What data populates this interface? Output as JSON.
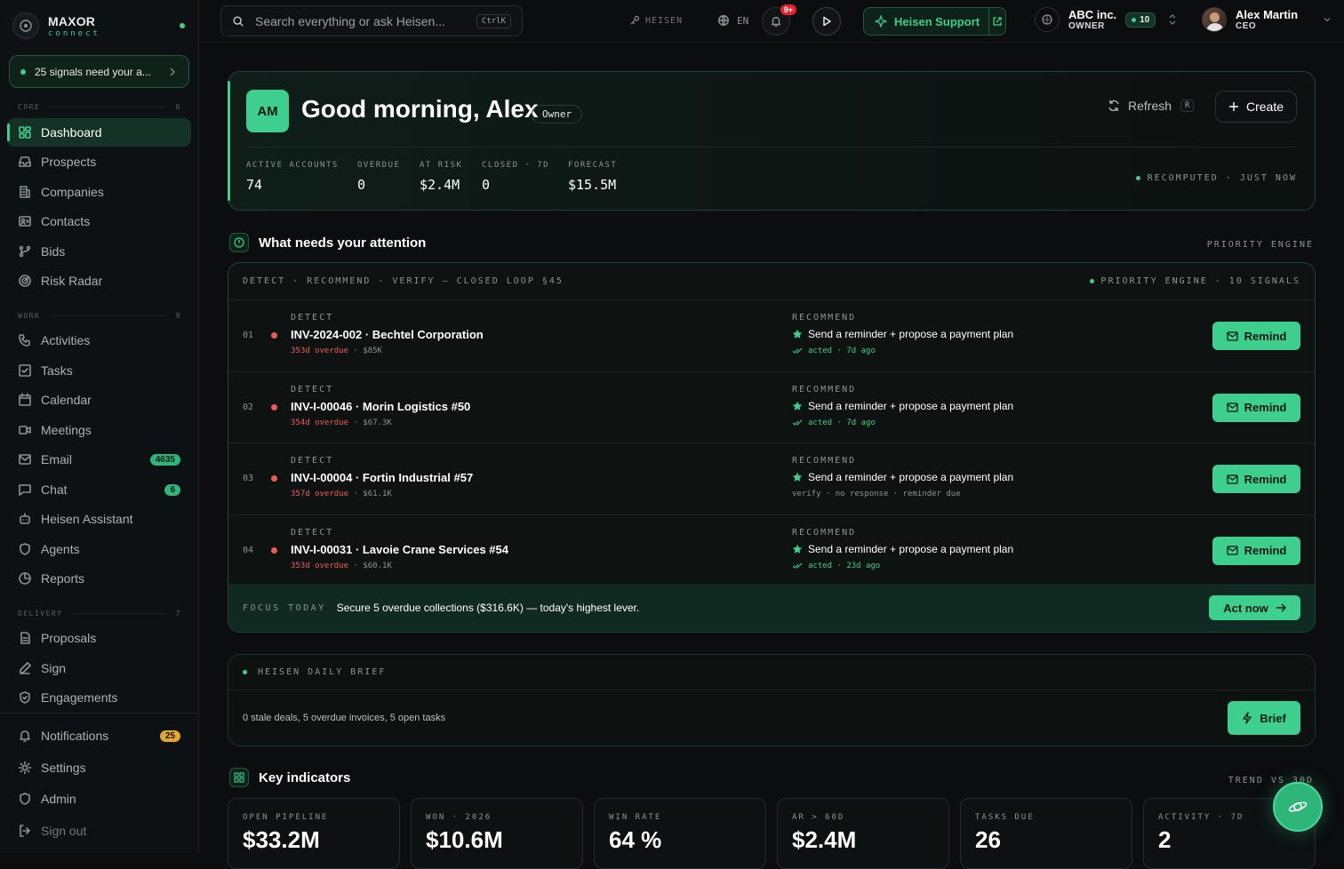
{
  "brand": {
    "name": "MAXOR",
    "sub": "connect"
  },
  "signals_banner": "25 signals need your a...",
  "sidebar": {
    "sections": [
      {
        "label": "CORE",
        "count": "6"
      },
      {
        "label": "WORK",
        "count": "9"
      },
      {
        "label": "DELIVERY",
        "count": "7"
      }
    ],
    "core": [
      {
        "label": "Dashboard",
        "icon": "dashboard-icon"
      },
      {
        "label": "Prospects",
        "icon": "inbox-icon"
      },
      {
        "label": "Companies",
        "icon": "building-icon"
      },
      {
        "label": "Contacts",
        "icon": "contact-card-icon"
      },
      {
        "label": "Bids",
        "icon": "branch-icon"
      },
      {
        "label": "Risk Radar",
        "icon": "radar-icon"
      }
    ],
    "work": [
      {
        "label": "Activities",
        "icon": "phone-icon"
      },
      {
        "label": "Tasks",
        "icon": "checkbox-icon"
      },
      {
        "label": "Calendar",
        "icon": "calendar-icon"
      },
      {
        "label": "Meetings",
        "icon": "video-icon"
      },
      {
        "label": "Email",
        "icon": "mail-icon",
        "badge": "4635"
      },
      {
        "label": "Chat",
        "icon": "chat-icon",
        "badge": "6"
      },
      {
        "label": "Heisen Assistant",
        "icon": "bot-icon"
      },
      {
        "label": "Agents",
        "icon": "shield-icon"
      },
      {
        "label": "Reports",
        "icon": "pie-chart-icon"
      }
    ],
    "delivery": [
      {
        "label": "Proposals",
        "icon": "document-icon"
      },
      {
        "label": "Sign",
        "icon": "pen-icon"
      },
      {
        "label": "Engagements",
        "icon": "shield-check-icon"
      }
    ],
    "bottom": [
      {
        "label": "Notifications",
        "icon": "bell-icon",
        "badge": "25"
      },
      {
        "label": "Settings",
        "icon": "gear-icon"
      },
      {
        "label": "Admin",
        "icon": "shield-icon"
      },
      {
        "label": "Sign out",
        "icon": "logout-icon"
      }
    ]
  },
  "topbar": {
    "search_placeholder": "Search everything or ask Heisen...",
    "search_kbd": "CtrlK",
    "heisen": "HEISEN",
    "lang": "EN",
    "notif_badge": "9+",
    "support": "Heisen Support",
    "org_name": "ABC inc.",
    "org_role": "OWNER",
    "org_count": "10",
    "user_name": "Alex Martin",
    "user_role": "CEO"
  },
  "hero": {
    "initials": "AM",
    "greeting": "Good morning, Alex",
    "role_tag": "Owner",
    "refresh": "Refresh",
    "refresh_kbd": "R",
    "create": "Create",
    "stats": [
      {
        "label": "ACTIVE ACCOUNTS",
        "value": "74"
      },
      {
        "label": "OVERDUE",
        "value": "0"
      },
      {
        "label": "AT RISK",
        "value": "$2.4M"
      },
      {
        "label": "CLOSED · 7D",
        "value": "0"
      },
      {
        "label": "FORECAST",
        "value": "$15.5M"
      }
    ],
    "recomputed": "RECOMPUTED · JUST NOW"
  },
  "attention": {
    "title": "What needs your attention",
    "right_label": "PRIORITY ENGINE",
    "head_left": "DETECT · RECOMMEND · VERIFY — CLOSED LOOP §45",
    "head_right": "PRIORITY ENGINE · 10 SIGNALS",
    "detect_label": "DETECT",
    "recommend_label": "RECOMMEND",
    "button_label": "Remind",
    "rows": [
      {
        "num": "01",
        "title": "INV-2024-002 · Bechtel Corporation",
        "overdue": "353d overdue",
        "amount": "$85K",
        "rec": "Send a reminder + propose a payment plan",
        "status": "acted · 7d ago"
      },
      {
        "num": "02",
        "title": "INV-I-00046 · Morin Logistics #50",
        "overdue": "354d overdue",
        "amount": "$67.3K",
        "rec": "Send a reminder + propose a payment plan",
        "status": "acted · 7d ago"
      },
      {
        "num": "03",
        "title": "INV-I-00004 · Fortin Industrial #57",
        "overdue": "357d overdue",
        "amount": "$61.1K",
        "rec": "Send a reminder + propose a payment plan",
        "status": "verify · no response · reminder due"
      },
      {
        "num": "04",
        "title": "INV-I-00031 · Lavoie Crane Services #54",
        "overdue": "353d overdue",
        "amount": "$60.1K",
        "rec": "Send a reminder + propose a payment plan",
        "status": "acted · 23d ago"
      }
    ],
    "focus_label": "FOCUS TODAY",
    "focus_text": "Secure 5 overdue collections ($316.6K) — today's highest lever.",
    "act_now": "Act now"
  },
  "brief": {
    "label": "HEISEN DAILY BRIEF",
    "text": "0 stale deals, 5 overdue invoices, 5 open tasks",
    "button": "Brief"
  },
  "kpis": {
    "title": "Key indicators",
    "right_label": "TREND VS 30D",
    "items": [
      {
        "label": "OPEN PIPELINE",
        "value": "$33.2M"
      },
      {
        "label": "WON · 2026",
        "value": "$10.6M"
      },
      {
        "label": "WIN RATE",
        "value": "64 %"
      },
      {
        "label": "AR > 60D",
        "value": "$2.4M"
      },
      {
        "label": "TASKS DUE",
        "value": "26"
      },
      {
        "label": "ACTIVITY · 7D",
        "value": "2"
      }
    ]
  }
}
